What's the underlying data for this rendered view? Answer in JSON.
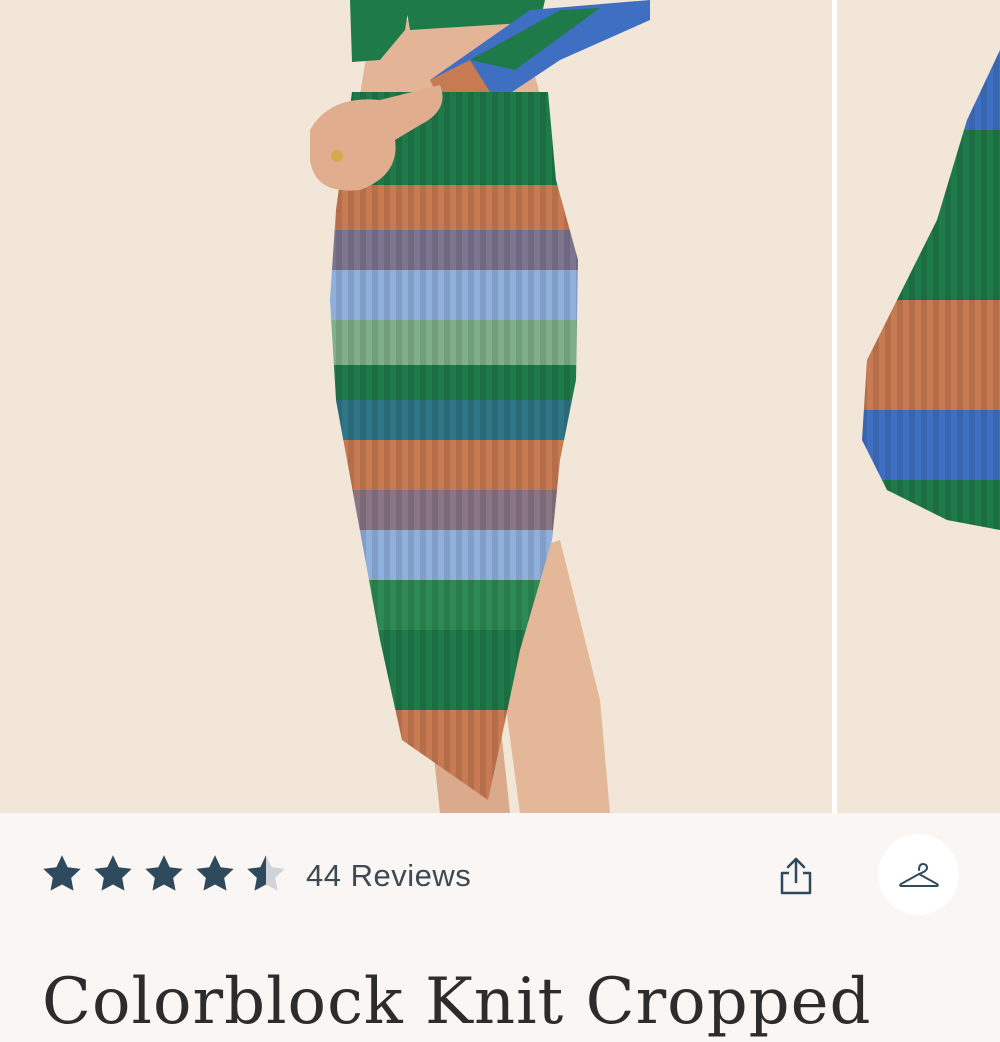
{
  "product": {
    "title": "Colorblock Knit Cropped",
    "rating": 4.5,
    "rating_max": 5,
    "reviews_label": "44 Reviews"
  },
  "gallery": {
    "images": [
      {
        "alt": "Model wearing colorblock ribbed knit midi skirt and cropped cardigan"
      },
      {
        "alt": "Close-up of colorblock knit sleeve"
      }
    ]
  },
  "icons": {
    "star": "star-icon",
    "share": "share-icon",
    "hanger": "hanger-icon"
  },
  "colors": {
    "star_fill": "#2f4a5c",
    "star_empty": "#cfd4d8",
    "background": "#faf6f3",
    "photo_bg": "#f1e6d7",
    "knit_green": "#1f7a4a",
    "knit_blue": "#3f6fc2",
    "knit_orange": "#c87a52",
    "knit_sky": "#8fb0dc"
  }
}
